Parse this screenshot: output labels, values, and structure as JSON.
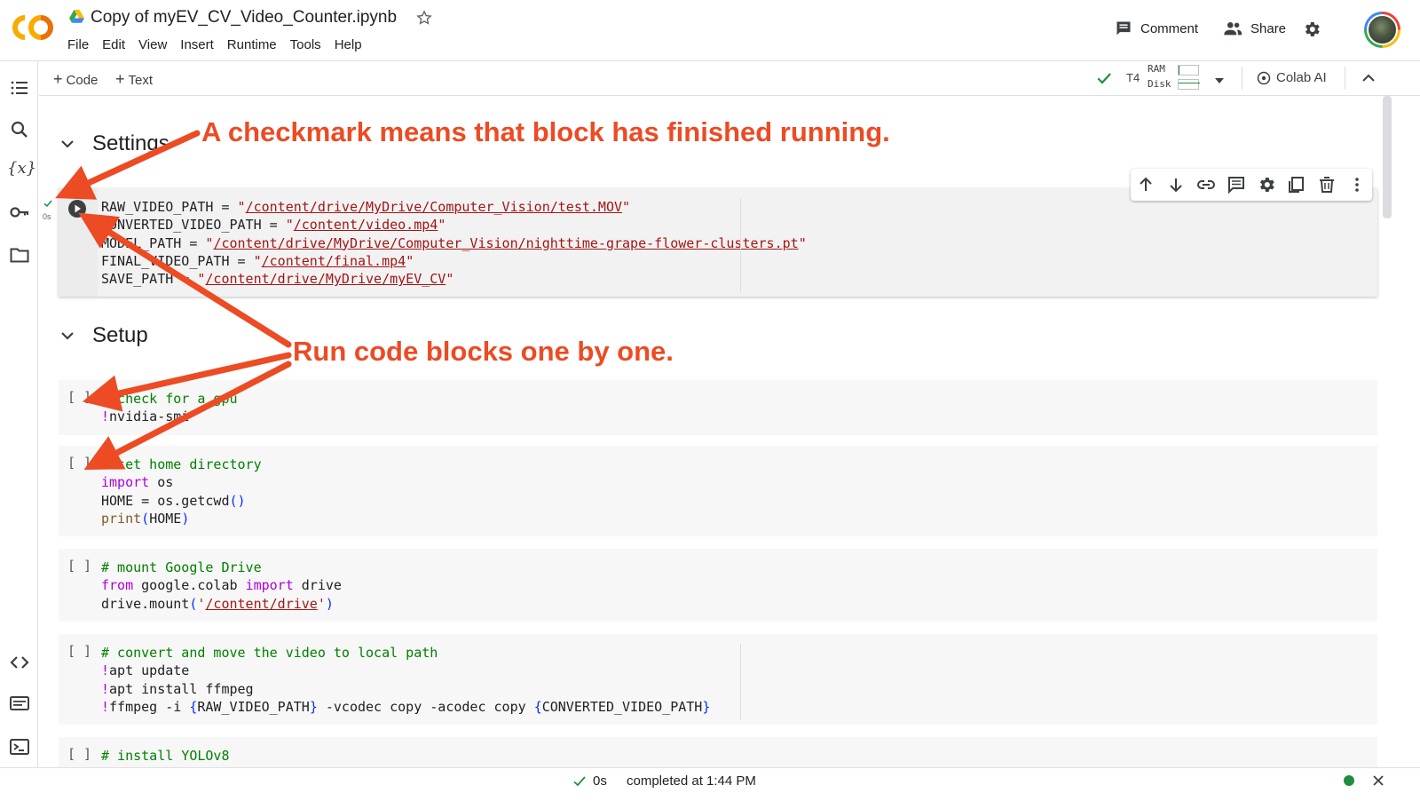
{
  "header": {
    "file_title": "Copy of myEV_CV_Video_Counter.ipynb",
    "logo_text": "CO",
    "menu": [
      "File",
      "Edit",
      "View",
      "Insert",
      "Runtime",
      "Tools",
      "Help"
    ],
    "comment_label": "Comment",
    "share_label": "Share"
  },
  "toolbar": {
    "add_code": "Code",
    "add_text": "Text",
    "runtime_type": "T4",
    "ram_label": "RAM",
    "disk_label": "Disk",
    "colab_ai_label": "Colab AI"
  },
  "sections": {
    "settings": "Settings",
    "setup": "Setup"
  },
  "cells": {
    "settings": {
      "exec_time": "0s",
      "lines": [
        {
          "var": "RAW_VIDEO_PATH",
          "value": "/content/drive/MyDrive/Computer_Vision/test.MOV"
        },
        {
          "var": "CONVERTED_VIDEO_PATH",
          "value": "/content/video.mp4"
        },
        {
          "var": "MODEL_PATH",
          "value": "/content/drive/MyDrive/Computer_Vision/nighttime-grape-flower-clusters.pt"
        },
        {
          "var": "FINAL_VIDEO_PATH",
          "value": "/content/final.mp4"
        },
        {
          "var": "SAVE_PATH",
          "value": "/content/drive/MyDrive/myEV_CV"
        }
      ]
    },
    "gpu": {
      "gutter": "[ ]",
      "comment": "# check for a gpu",
      "cmd": "nvidia-smi"
    },
    "home": {
      "gutter": "[ ]",
      "comment": "# set home directory",
      "kw_import": "import",
      "mod_os": "os",
      "line2": "HOME = os.getcwd",
      "fn_print": "print",
      "arg": "HOME"
    },
    "mount": {
      "gutter": "[ ]",
      "comment": "# mount Google Drive",
      "kw_from": "from",
      "module": "google.colab",
      "kw_import": "import",
      "name": "drive",
      "call": "drive.mount",
      "path": "/content/drive"
    },
    "convert": {
      "gutter": "[ ]",
      "comment": "# convert and move the video to local path",
      "l1": "apt update",
      "l2": "apt install ffmpeg",
      "l3a": "ffmpeg -i ",
      "l3b": "RAW_VIDEO_PATH",
      "l3c": " -vcodec copy -acodec copy ",
      "l3d": "CONVERTED_VIDEO_PATH"
    },
    "yolo": {
      "gutter": "[ ]",
      "comment": "# install YOLOv8"
    }
  },
  "statusbar": {
    "duration": "0s",
    "completed": "completed at 1:44 PM"
  },
  "annotations": {
    "checkmark_note": "A checkmark means that block has finished running.",
    "run_note": "Run code blocks one by one."
  },
  "colors": {
    "annotation": "#ec4b23",
    "string": "#a31515",
    "comment": "#008000",
    "keyword": "#af00db",
    "status_ok": "#1e8e3e"
  },
  "icons": [
    "drive-icon",
    "star-icon",
    "comment-icon",
    "share-people-icon",
    "gear-icon",
    "toc-icon",
    "search-icon",
    "variables-icon",
    "key-icon",
    "folder-icon",
    "code-snippets-icon",
    "command-palette-icon",
    "terminal-icon",
    "check-icon",
    "dropdown-icon",
    "colab-ai-icon",
    "collapse-icon",
    "chevron-down-icon",
    "run-icon",
    "arrow-up-icon",
    "arrow-down-icon",
    "link-icon",
    "comment-cell-icon",
    "cell-settings-icon",
    "mirror-cell-icon",
    "delete-icon",
    "more-vert-icon",
    "close-icon"
  ]
}
